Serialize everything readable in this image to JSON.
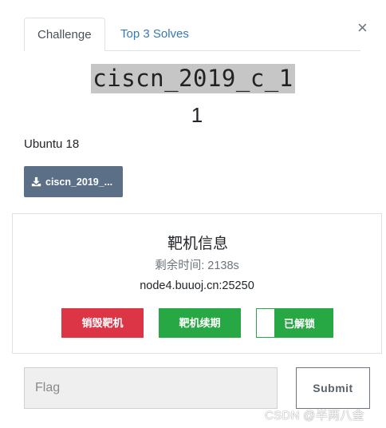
{
  "tabs": {
    "challenge": "Challenge",
    "solves": "Top 3 Solves"
  },
  "close_glyph": "×",
  "challenge": {
    "name": "ciscn_2019_c_1",
    "points": "1",
    "description": "Ubuntu 18",
    "file_label": "ciscn_2019_..."
  },
  "instance": {
    "title": "靶机信息",
    "timer": "剩余时间: 2138s",
    "host": "node4.buuoj.cn:25250",
    "destroy_label": "销毁靶机",
    "renew_label": "靶机续期",
    "unlock_label": "已解锁"
  },
  "flag": {
    "placeholder": "Flag",
    "submit_label": "Submit"
  },
  "watermark": "CSDN @半两八金",
  "icons": {
    "download": "download-icon",
    "close": "close-icon"
  },
  "colors": {
    "danger": "#dc3545",
    "success": "#28a745",
    "file_button": "#5b6f87",
    "link": "#337ab7"
  }
}
